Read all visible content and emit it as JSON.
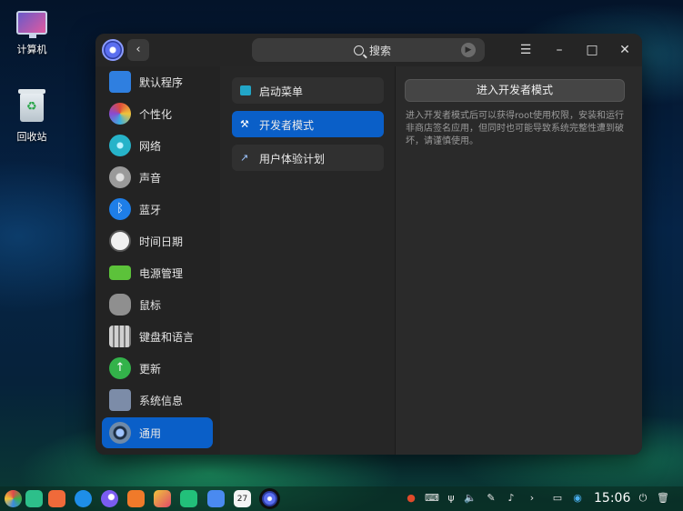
{
  "desktop": {
    "icons": [
      {
        "label": "计算机"
      },
      {
        "label": "回收站"
      }
    ]
  },
  "window": {
    "search_placeholder": "搜索",
    "sidebar": [
      {
        "label": "默认程序",
        "icon": "default-apps-icon",
        "color": "#2f7fe0"
      },
      {
        "label": "个性化",
        "icon": "personalization-icon",
        "color": "#e07a3a"
      },
      {
        "label": "网络",
        "icon": "network-icon",
        "color": "#26b3c9"
      },
      {
        "label": "声音",
        "icon": "sound-icon",
        "color": "#9a9a9a"
      },
      {
        "label": "蓝牙",
        "icon": "bluetooth-icon",
        "color": "#1e7ee8"
      },
      {
        "label": "时间日期",
        "icon": "clock-icon",
        "color": "#f0f0f0"
      },
      {
        "label": "电源管理",
        "icon": "battery-icon",
        "color": "#5cc23a"
      },
      {
        "label": "鼠标",
        "icon": "mouse-icon",
        "color": "#8f8f8f"
      },
      {
        "label": "键盘和语言",
        "icon": "keyboard-icon",
        "color": "#a0a0a0"
      },
      {
        "label": "更新",
        "icon": "update-icon",
        "color": "#33b24a"
      },
      {
        "label": "系统信息",
        "icon": "system-info-icon",
        "color": "#7c8ca8"
      },
      {
        "label": "通用",
        "icon": "general-icon",
        "color": "#3f5a78",
        "active": true
      }
    ],
    "sublist": [
      {
        "label": "启动菜单",
        "icon": "boot-menu-icon"
      },
      {
        "label": "开发者模式",
        "icon": "tools-icon",
        "active": true
      },
      {
        "label": "用户体验计划",
        "icon": "chart-icon"
      }
    ],
    "content": {
      "button_label": "进入开发者模式",
      "description": "进入开发者模式后可以获得root使用权限，安装和运行非商店签名应用，但同时也可能导致系统完整性遭到破坏，请谨慎使用。"
    }
  },
  "taskbar": {
    "apps": [
      {
        "icon": "launcher-icon",
        "color": "#e8e8e8"
      },
      {
        "icon": "file-manager-icon",
        "color": "#2dbf8a"
      },
      {
        "icon": "multitask-icon",
        "color": "#f06a3a"
      },
      {
        "icon": "app-store-icon",
        "color": "#1e8ee8"
      },
      {
        "icon": "browser-icon",
        "color": "#7a5cf0"
      },
      {
        "icon": "notes-icon",
        "color": "#f07a2a"
      },
      {
        "icon": "image-viewer-icon",
        "color": "#e04a6a"
      },
      {
        "icon": "music-icon",
        "color": "#22c07a"
      },
      {
        "icon": "document-viewer-icon",
        "color": "#4a8af0"
      },
      {
        "icon": "calendar-icon",
        "color": "#f4f4f4",
        "text": "27"
      },
      {
        "icon": "control-center-icon",
        "color": "#3a3fbf"
      }
    ],
    "clock": "15:06"
  }
}
